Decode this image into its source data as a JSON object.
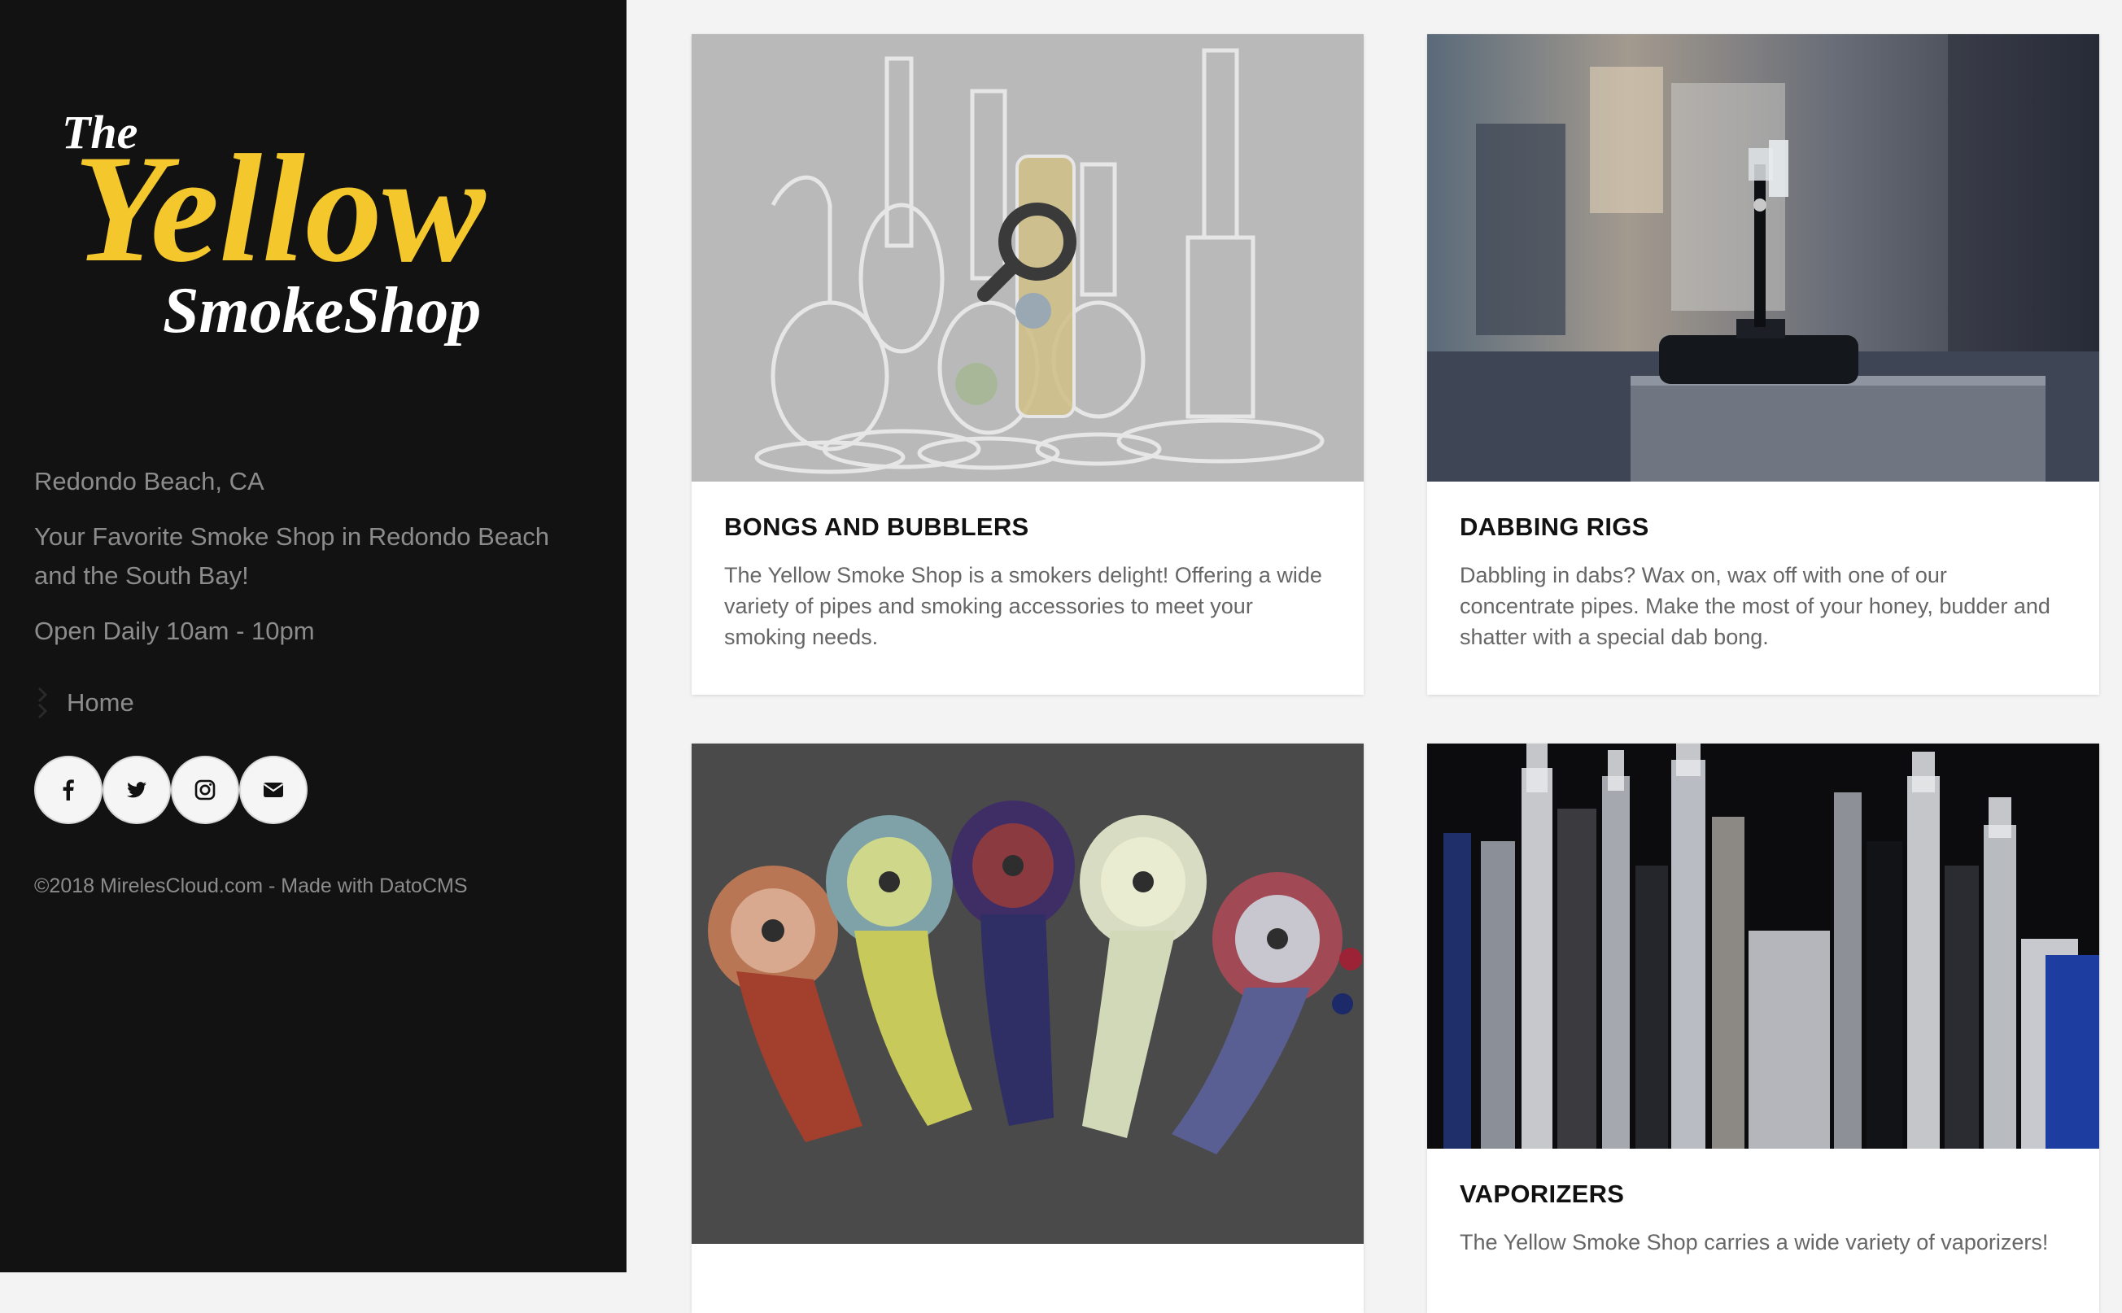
{
  "sidebar": {
    "logo": {
      "line1": "The",
      "line2": "Yellow",
      "line3": "SmokeShop"
    },
    "location": "Redondo Beach, CA",
    "tagline": "Your Favorite Smoke Shop in Redondo Beach and the South Bay!",
    "hours": "Open Daily 10am - 10pm",
    "nav": [
      {
        "label": "Home",
        "icon": "chevron-right-icon"
      }
    ],
    "social": [
      {
        "name": "facebook",
        "icon": "facebook-icon"
      },
      {
        "name": "twitter",
        "icon": "twitter-icon"
      },
      {
        "name": "instagram",
        "icon": "instagram-icon"
      },
      {
        "name": "email",
        "icon": "envelope-icon"
      }
    ],
    "copyright": "©2018 MirelesCloud.com - Made with DatoCMS"
  },
  "cards": [
    {
      "title": "BONGS AND BUBBLERS",
      "description": "The Yellow Smoke Shop is a smokers delight! Offering a wide variety of pipes and smoking accessories to meet your smoking needs.",
      "image": "glass-bongs-photo",
      "hover_icon": "magnifier-icon"
    },
    {
      "title": "DABBING RIGS",
      "description": "Dabbling in dabs? Wax on, wax off with one of our concentrate pipes. Make the most of your honey, budder and shatter with a special dab bong.",
      "image": "dab-rig-photo"
    },
    {
      "title": "",
      "description": "",
      "image": "glass-spoon-pipes-photo"
    },
    {
      "title": "VAPORIZERS",
      "description": "The Yellow Smoke Shop carries a wide variety of vaporizers!",
      "image": "vaporizers-photo"
    }
  ],
  "colors": {
    "sidebar_bg": "#121212",
    "logo_yellow": "#f4c72d",
    "page_bg": "#f3f3f3",
    "text_muted": "#8c8c8c"
  }
}
